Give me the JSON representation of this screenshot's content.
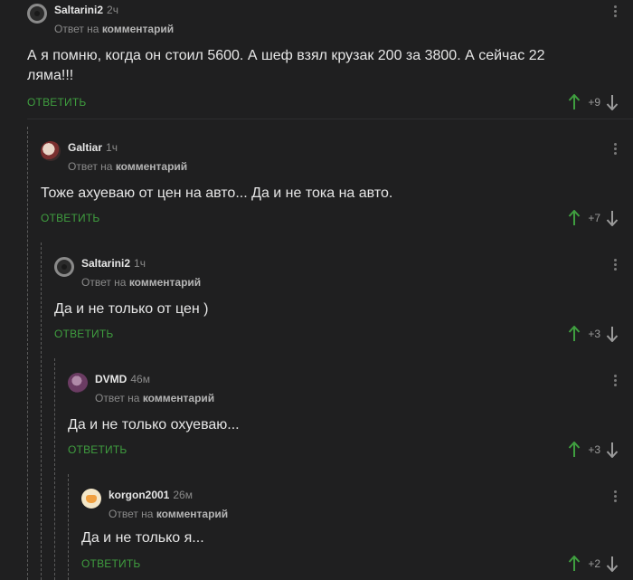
{
  "reply_word": "Ответ на",
  "reply_target": "комментарий",
  "reply_button": "ОТВЕТИТЬ",
  "comments": [
    {
      "author": "Saltarini2",
      "time": "2ч",
      "avatar_icon": "gear-avatar-icon",
      "text": [
        "А я помню, когда он стоил 5600. А шеф взял крузак 200 за 3800. А сейчас 22",
        "ляма!!!"
      ],
      "rating": "+9"
    },
    {
      "author": "Galtiar",
      "time": "1ч",
      "avatar_icon": "galtiar-avatar-icon",
      "text": [
        "Тоже ахуеваю от цен на авто... Да и не тока на авто."
      ],
      "rating": "+7"
    },
    {
      "author": "Saltarini2",
      "time": "1ч",
      "avatar_icon": "gear-avatar-icon",
      "text": [
        "Да и не только от цен )"
      ],
      "rating": "+3"
    },
    {
      "author": "DVMD",
      "time": "46м",
      "avatar_icon": "dvmd-avatar-icon",
      "text": [
        "Да и не только охуеваю..."
      ],
      "rating": "+3"
    },
    {
      "author": "korgon2001",
      "time": "26м",
      "avatar_icon": "korgon-avatar-icon",
      "text": [
        "Да и не только я..."
      ],
      "rating": "+2"
    }
  ]
}
